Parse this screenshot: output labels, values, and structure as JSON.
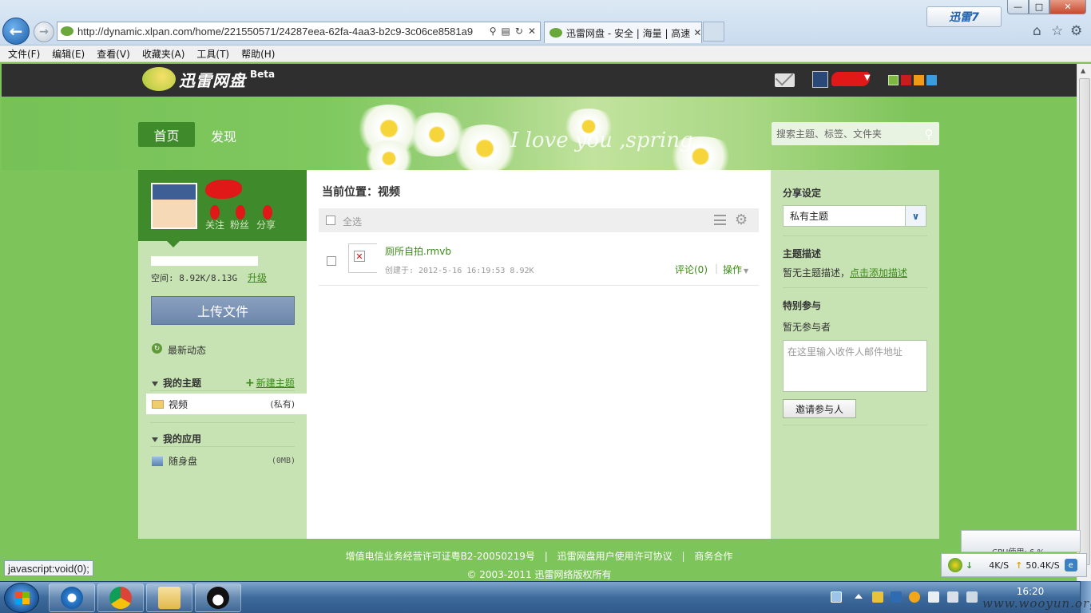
{
  "browser": {
    "url": "http://dynamic.xlpan.com/home/221550571/24287eea-62fa-4aa3-b2c9-3c06ce8581a9",
    "tab_title": "迅雷网盘 - 安全 | 海量 | 高速",
    "badge": "迅雷7",
    "menu": [
      "文件(F)",
      "编辑(E)",
      "查看(V)",
      "收藏夹(A)",
      "工具(T)",
      "帮助(H)"
    ],
    "status_text": "javascript:void(0);"
  },
  "site": {
    "logo_text": "迅雷网盘",
    "beta_label": "Beta",
    "slogan": "I love you ,spring",
    "nav": {
      "home": "首页",
      "discover": "发现"
    },
    "search_placeholder": "搜索主题、标签、文件夹",
    "theme_colors": [
      "#7fb840",
      "#c81d1d",
      "#f09a16",
      "#3b9de0"
    ]
  },
  "left": {
    "stats": {
      "follow": "关注",
      "fans": "粉丝",
      "share": "分享"
    },
    "quota_text": "空间: 8.92K/8.13G",
    "upgrade_label": "升级",
    "upload_label": "上传文件",
    "news_label": "最新动态",
    "my_topics_label": "我的主题",
    "new_topic_label": "新建主题",
    "topic": {
      "name": "视频",
      "tag": "(私有)"
    },
    "my_apps_label": "我的应用",
    "app": {
      "name": "随身盘",
      "size": "(0MB)"
    }
  },
  "center": {
    "breadcrumb": "当前位置：视频",
    "select_all": "全选",
    "file": {
      "name": "厕所自拍.rmvb",
      "meta": "创建于: 2012-5-16 16:19:53 8.92K",
      "comment": "评论(0)",
      "separator": "|",
      "action": "操作"
    }
  },
  "right": {
    "share_settings_label": "分享设定",
    "share_mode": "私有主题",
    "desc_label": "主题描述",
    "desc_empty": "暂无主题描述，",
    "desc_add_link": "点击添加描述",
    "participants_label": "特别参与",
    "participants_empty": "暂无参与者",
    "invite_placeholder": "在这里输入收件人邮件地址",
    "invite_button": "邀请参与人"
  },
  "footer": {
    "license": "增值电信业务经营许可证粤B2-20050219号",
    "agreement": "迅雷网盘用户使用许可协议",
    "business": "商务合作",
    "separator": "|",
    "copyright": "© 2003-2011 迅雷网络版权所有"
  },
  "speed_widget": {
    "cpu_tip": "CPU使用: 6 %",
    "down": "4K/S",
    "up": "50.4K/S"
  },
  "taskbar": {
    "time": "16:20",
    "watermark": "www.wooyun.org"
  }
}
